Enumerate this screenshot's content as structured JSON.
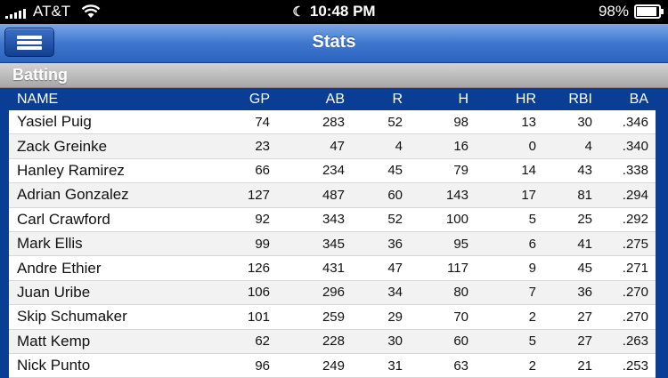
{
  "status": {
    "carrier": "AT&T",
    "time": "10:48 PM",
    "battery": "98%",
    "battery_level": 0.98
  },
  "nav": {
    "title": "Stats"
  },
  "section": {
    "title": "Batting"
  },
  "table": {
    "headers": {
      "name": "NAME",
      "gp": "GP",
      "ab": "AB",
      "r": "R",
      "h": "H",
      "hr": "HR",
      "rbi": "RBI",
      "ba": "BA"
    },
    "rows": [
      {
        "name": "Yasiel Puig",
        "gp": "74",
        "ab": "283",
        "r": "52",
        "h": "98",
        "hr": "13",
        "rbi": "30",
        "ba": ".346"
      },
      {
        "name": "Zack Greinke",
        "gp": "23",
        "ab": "47",
        "r": "4",
        "h": "16",
        "hr": "0",
        "rbi": "4",
        "ba": ".340"
      },
      {
        "name": "Hanley Ramirez",
        "gp": "66",
        "ab": "234",
        "r": "45",
        "h": "79",
        "hr": "14",
        "rbi": "43",
        "ba": ".338"
      },
      {
        "name": "Adrian Gonzalez",
        "gp": "127",
        "ab": "487",
        "r": "60",
        "h": "143",
        "hr": "17",
        "rbi": "81",
        "ba": ".294"
      },
      {
        "name": "Carl Crawford",
        "gp": "92",
        "ab": "343",
        "r": "52",
        "h": "100",
        "hr": "5",
        "rbi": "25",
        "ba": ".292"
      },
      {
        "name": "Mark Ellis",
        "gp": "99",
        "ab": "345",
        "r": "36",
        "h": "95",
        "hr": "6",
        "rbi": "41",
        "ba": ".275"
      },
      {
        "name": "Andre Ethier",
        "gp": "126",
        "ab": "431",
        "r": "47",
        "h": "117",
        "hr": "9",
        "rbi": "45",
        "ba": ".271"
      },
      {
        "name": "Juan Uribe",
        "gp": "106",
        "ab": "296",
        "r": "34",
        "h": "80",
        "hr": "7",
        "rbi": "36",
        "ba": ".270"
      },
      {
        "name": "Skip Schumaker",
        "gp": "101",
        "ab": "259",
        "r": "29",
        "h": "70",
        "hr": "2",
        "rbi": "27",
        "ba": ".270"
      },
      {
        "name": "Matt Kemp",
        "gp": "62",
        "ab": "228",
        "r": "30",
        "h": "60",
        "hr": "5",
        "rbi": "27",
        "ba": ".263"
      },
      {
        "name": "Nick Punto",
        "gp": "96",
        "ab": "249",
        "r": "31",
        "h": "63",
        "hr": "2",
        "rbi": "21",
        "ba": ".253"
      }
    ]
  }
}
